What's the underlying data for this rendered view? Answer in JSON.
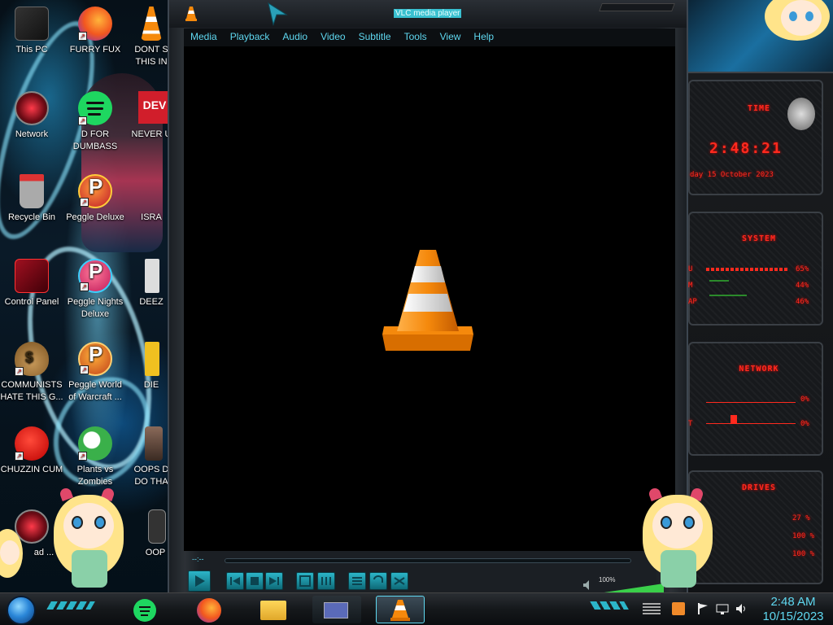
{
  "desktop": {
    "icons": [
      {
        "label": "This PC"
      },
      {
        "label": "FURRY FUX"
      },
      {
        "label": "DONT S THIS IN"
      },
      {
        "label": "Network"
      },
      {
        "label": "D FOR DUMBASS"
      },
      {
        "label": "NEVER U"
      },
      {
        "label": "Recycle Bin"
      },
      {
        "label": "Peggle Deluxe"
      },
      {
        "label": "ISRA"
      },
      {
        "label": "Control Panel"
      },
      {
        "label": "Peggle Nights Deluxe"
      },
      {
        "label": "DEEZ"
      },
      {
        "label": "COMMUNISTS HATE THIS G..."
      },
      {
        "label": "Peggle World of Warcraft ..."
      },
      {
        "label": "DIE"
      },
      {
        "label": "CHUZZIN CUM"
      },
      {
        "label": "Plants vs Zombies"
      },
      {
        "label": "OOPS D DO THA"
      },
      {
        "label": "ad ..."
      },
      {
        "label": "OOP"
      }
    ],
    "wallpaper_badge": "DEV"
  },
  "vlc": {
    "title": "VLC media player",
    "menu": [
      "Media",
      "Playback",
      "Audio",
      "Video",
      "Subtitle",
      "Tools",
      "View",
      "Help"
    ],
    "seek_time": "--:--",
    "seek_time_end": "-",
    "volume_label": "100%",
    "volume_level": 1.0,
    "colors": {
      "accent": "#5fd8f0",
      "cone_orange": "#f5890c",
      "cone_white": "#e8e8e8"
    },
    "controls": [
      "play-icon",
      "prev-icon",
      "stop-icon",
      "next-icon",
      "fullscreen-icon",
      "extended-settings-icon",
      "playlist-icon",
      "loop-icon",
      "shuffle-icon"
    ]
  },
  "gadgets": {
    "time": {
      "title": "TIME",
      "clock": "2:48:21",
      "date": "day 15 October 2023"
    },
    "system": {
      "title": "SYSTEM",
      "rows": [
        {
          "label": "U",
          "value": "65%"
        },
        {
          "label": "M",
          "value": "44%"
        },
        {
          "label": "AP",
          "value": "46%"
        }
      ]
    },
    "network": {
      "title": "NETWORK",
      "rows": [
        {
          "label": "",
          "value": "0%"
        },
        {
          "label": "T",
          "value": "0%"
        }
      ]
    },
    "drives": {
      "title": "DRIVES",
      "rows": [
        {
          "value": "27 %"
        },
        {
          "value": "100 %"
        },
        {
          "value": "100 %"
        }
      ]
    },
    "colors": {
      "led_red": "#ff2a1e"
    }
  },
  "taskbar": {
    "apps": [
      "spotify-icon",
      "firefox-icon",
      "file-explorer-icon",
      "remote-desktop-icon",
      "vlc-icon"
    ],
    "active_app": "vlc-icon",
    "tray": [
      "sound-meter-icon",
      "flag-icon",
      "network-icon",
      "volume-icon"
    ],
    "clock_time": "2:48 AM",
    "clock_date": "10/15/2023"
  }
}
